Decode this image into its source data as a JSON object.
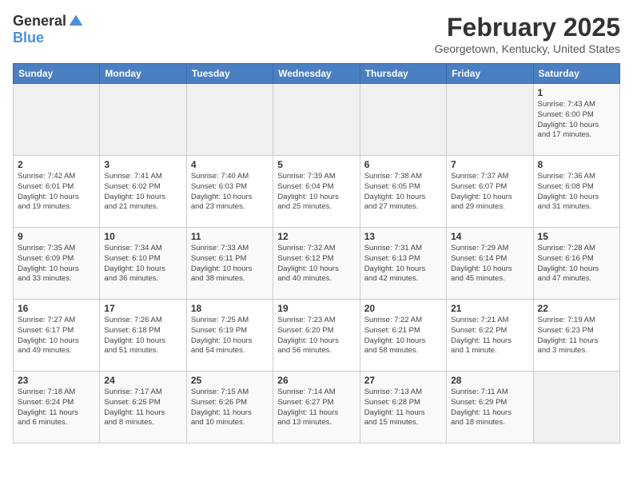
{
  "header": {
    "logo": {
      "general": "General",
      "blue": "Blue"
    },
    "title": "February 2025",
    "location": "Georgetown, Kentucky, United States"
  },
  "weekdays": [
    "Sunday",
    "Monday",
    "Tuesday",
    "Wednesday",
    "Thursday",
    "Friday",
    "Saturday"
  ],
  "weeks": [
    [
      {
        "day": "",
        "info": ""
      },
      {
        "day": "",
        "info": ""
      },
      {
        "day": "",
        "info": ""
      },
      {
        "day": "",
        "info": ""
      },
      {
        "day": "",
        "info": ""
      },
      {
        "day": "",
        "info": ""
      },
      {
        "day": "1",
        "info": "Sunrise: 7:43 AM\nSunset: 6:00 PM\nDaylight: 10 hours\nand 17 minutes."
      }
    ],
    [
      {
        "day": "2",
        "info": "Sunrise: 7:42 AM\nSunset: 6:01 PM\nDaylight: 10 hours\nand 19 minutes."
      },
      {
        "day": "3",
        "info": "Sunrise: 7:41 AM\nSunset: 6:02 PM\nDaylight: 10 hours\nand 21 minutes."
      },
      {
        "day": "4",
        "info": "Sunrise: 7:40 AM\nSunset: 6:03 PM\nDaylight: 10 hours\nand 23 minutes."
      },
      {
        "day": "5",
        "info": "Sunrise: 7:39 AM\nSunset: 6:04 PM\nDaylight: 10 hours\nand 25 minutes."
      },
      {
        "day": "6",
        "info": "Sunrise: 7:38 AM\nSunset: 6:05 PM\nDaylight: 10 hours\nand 27 minutes."
      },
      {
        "day": "7",
        "info": "Sunrise: 7:37 AM\nSunset: 6:07 PM\nDaylight: 10 hours\nand 29 minutes."
      },
      {
        "day": "8",
        "info": "Sunrise: 7:36 AM\nSunset: 6:08 PM\nDaylight: 10 hours\nand 31 minutes."
      }
    ],
    [
      {
        "day": "9",
        "info": "Sunrise: 7:35 AM\nSunset: 6:09 PM\nDaylight: 10 hours\nand 33 minutes."
      },
      {
        "day": "10",
        "info": "Sunrise: 7:34 AM\nSunset: 6:10 PM\nDaylight: 10 hours\nand 36 minutes."
      },
      {
        "day": "11",
        "info": "Sunrise: 7:33 AM\nSunset: 6:11 PM\nDaylight: 10 hours\nand 38 minutes."
      },
      {
        "day": "12",
        "info": "Sunrise: 7:32 AM\nSunset: 6:12 PM\nDaylight: 10 hours\nand 40 minutes."
      },
      {
        "day": "13",
        "info": "Sunrise: 7:31 AM\nSunset: 6:13 PM\nDaylight: 10 hours\nand 42 minutes."
      },
      {
        "day": "14",
        "info": "Sunrise: 7:29 AM\nSunset: 6:14 PM\nDaylight: 10 hours\nand 45 minutes."
      },
      {
        "day": "15",
        "info": "Sunrise: 7:28 AM\nSunset: 6:16 PM\nDaylight: 10 hours\nand 47 minutes."
      }
    ],
    [
      {
        "day": "16",
        "info": "Sunrise: 7:27 AM\nSunset: 6:17 PM\nDaylight: 10 hours\nand 49 minutes."
      },
      {
        "day": "17",
        "info": "Sunrise: 7:26 AM\nSunset: 6:18 PM\nDaylight: 10 hours\nand 51 minutes."
      },
      {
        "day": "18",
        "info": "Sunrise: 7:25 AM\nSunset: 6:19 PM\nDaylight: 10 hours\nand 54 minutes."
      },
      {
        "day": "19",
        "info": "Sunrise: 7:23 AM\nSunset: 6:20 PM\nDaylight: 10 hours\nand 56 minutes."
      },
      {
        "day": "20",
        "info": "Sunrise: 7:22 AM\nSunset: 6:21 PM\nDaylight: 10 hours\nand 58 minutes."
      },
      {
        "day": "21",
        "info": "Sunrise: 7:21 AM\nSunset: 6:22 PM\nDaylight: 11 hours\nand 1 minute."
      },
      {
        "day": "22",
        "info": "Sunrise: 7:19 AM\nSunset: 6:23 PM\nDaylight: 11 hours\nand 3 minutes."
      }
    ],
    [
      {
        "day": "23",
        "info": "Sunrise: 7:18 AM\nSunset: 6:24 PM\nDaylight: 11 hours\nand 6 minutes."
      },
      {
        "day": "24",
        "info": "Sunrise: 7:17 AM\nSunset: 6:25 PM\nDaylight: 11 hours\nand 8 minutes."
      },
      {
        "day": "25",
        "info": "Sunrise: 7:15 AM\nSunset: 6:26 PM\nDaylight: 11 hours\nand 10 minutes."
      },
      {
        "day": "26",
        "info": "Sunrise: 7:14 AM\nSunset: 6:27 PM\nDaylight: 11 hours\nand 13 minutes."
      },
      {
        "day": "27",
        "info": "Sunrise: 7:13 AM\nSunset: 6:28 PM\nDaylight: 11 hours\nand 15 minutes."
      },
      {
        "day": "28",
        "info": "Sunrise: 7:11 AM\nSunset: 6:29 PM\nDaylight: 11 hours\nand 18 minutes."
      },
      {
        "day": "",
        "info": ""
      }
    ]
  ]
}
